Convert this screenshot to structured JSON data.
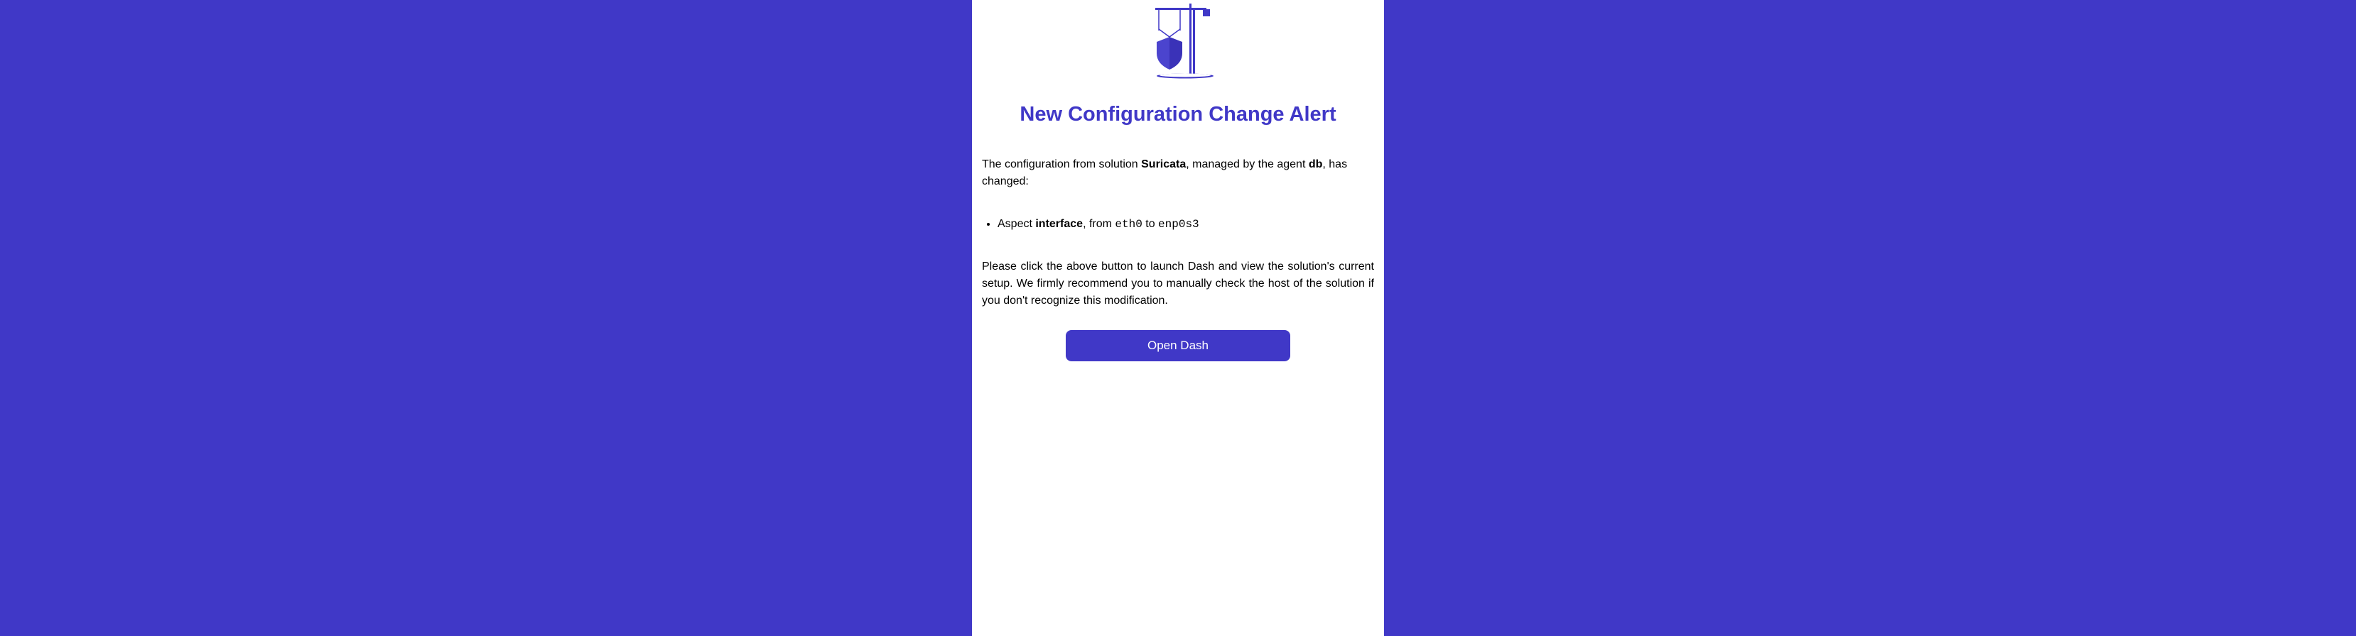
{
  "title": "New Configuration Change Alert",
  "intro": {
    "prefix": "The configuration from solution ",
    "solution": "Suricata",
    "middle": ", managed by the agent ",
    "agent": "db",
    "suffix": ", has changed:"
  },
  "change": {
    "prefix": "Aspect ",
    "aspect": "interface",
    "from_label": ", from ",
    "from_value": "eth0",
    "to_label": " to ",
    "to_value": "enp0s3"
  },
  "recommendation": "Please click the above button to launch Dash and view the solution's current setup. We firmly recommend you to manually check the host of the solution if you don't recognize this modification.",
  "button_label": "Open Dash",
  "colors": {
    "primary": "#4038c7",
    "background": "#ffffff"
  }
}
